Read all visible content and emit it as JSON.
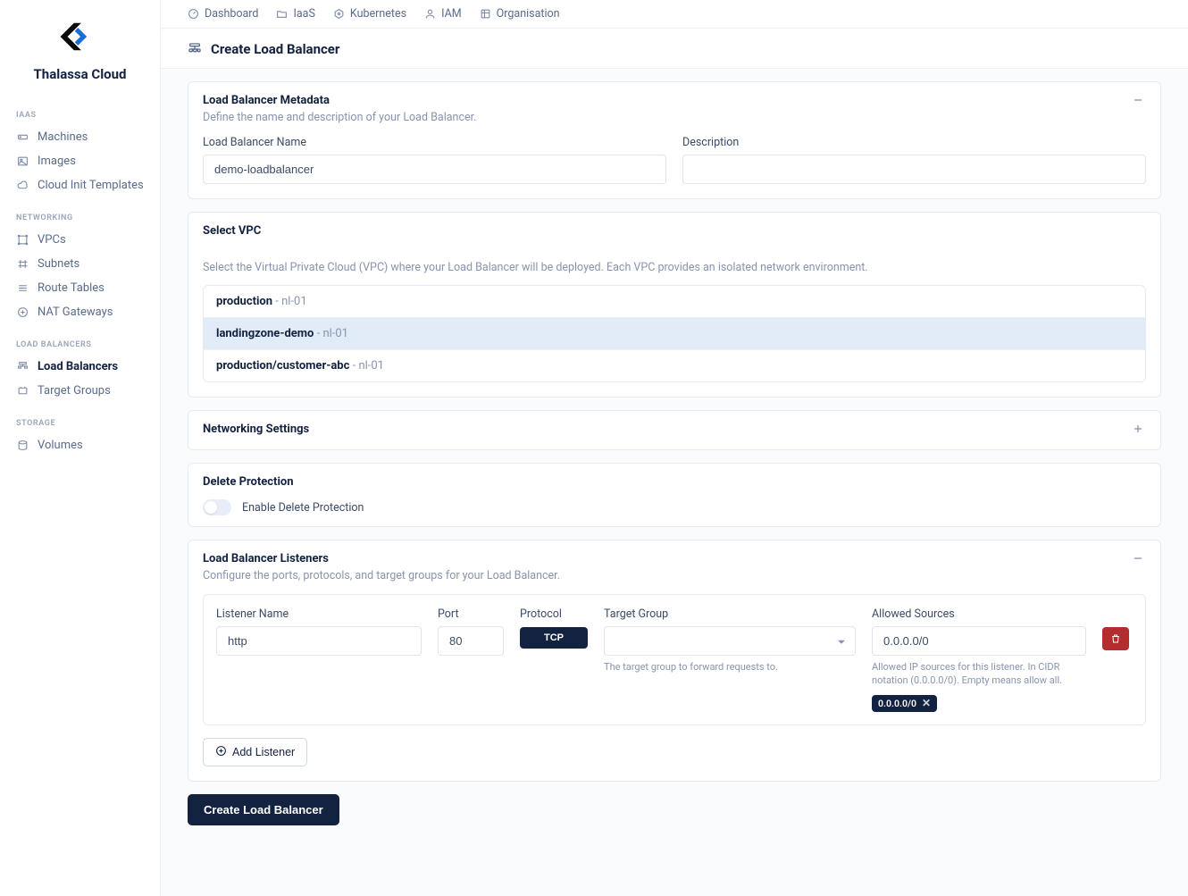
{
  "brand": "Thalassa Cloud",
  "topnav": [
    {
      "label": "Dashboard",
      "icon": "dashboard-icon"
    },
    {
      "label": "IaaS",
      "icon": "folder-icon"
    },
    {
      "label": "Kubernetes",
      "icon": "kubernetes-icon"
    },
    {
      "label": "IAM",
      "icon": "user-icon"
    },
    {
      "label": "Organisation",
      "icon": "org-icon"
    }
  ],
  "pageTitle": "Create Load Balancer",
  "sidebar": {
    "groups": [
      {
        "heading": "IAAS",
        "items": [
          {
            "label": "Machines",
            "icon": "server-icon"
          },
          {
            "label": "Images",
            "icon": "image-icon"
          },
          {
            "label": "Cloud Init Templates",
            "icon": "cloud-icon"
          }
        ]
      },
      {
        "heading": "NETWORKING",
        "items": [
          {
            "label": "VPCs",
            "icon": "vpc-icon"
          },
          {
            "label": "Subnets",
            "icon": "subnet-icon"
          },
          {
            "label": "Route Tables",
            "icon": "route-icon"
          },
          {
            "label": "NAT Gateways",
            "icon": "nat-icon"
          }
        ]
      },
      {
        "heading": "LOAD BALANCERS",
        "items": [
          {
            "label": "Load Balancers",
            "icon": "lb-icon",
            "active": true
          },
          {
            "label": "Target Groups",
            "icon": "target-icon"
          }
        ]
      },
      {
        "heading": "STORAGE",
        "items": [
          {
            "label": "Volumes",
            "icon": "disk-icon"
          }
        ]
      }
    ]
  },
  "metadataCard": {
    "title": "Load Balancer Metadata",
    "sub": "Define the name and description of your Load Balancer.",
    "nameLabel": "Load Balancer Name",
    "nameValue": "demo-loadbalancer",
    "descLabel": "Description",
    "descValue": ""
  },
  "vpcCard": {
    "title": "Select VPC",
    "help": "Select the Virtual Private Cloud (VPC) where your Load Balancer will be deployed. Each VPC provides an isolated network environment.",
    "items": [
      {
        "name": "production",
        "region": "nl-01",
        "selected": false
      },
      {
        "name": "landingzone-demo",
        "region": "nl-01",
        "selected": true
      },
      {
        "name": "production/customer-abc",
        "region": "nl-01",
        "selected": false
      }
    ]
  },
  "netCard": {
    "title": "Networking Settings"
  },
  "deleteCard": {
    "title": "Delete Protection",
    "toggleLabel": "Enable Delete Protection",
    "enabled": false
  },
  "listenersCard": {
    "title": "Load Balancer Listeners",
    "sub": "Configure the ports, protocols, and target groups for your Load Balancer.",
    "headers": {
      "name": "Listener Name",
      "port": "Port",
      "protocol": "Protocol",
      "targetGroup": "Target Group",
      "sources": "Allowed Sources"
    },
    "tgHelp": "The target group to forward requests to.",
    "sourcesHelp": "Allowed IP sources for this listener. In CIDR notation (0.0.0.0/0). Empty means allow all.",
    "listeners": [
      {
        "name": "http",
        "port": "80",
        "protocol": "TCP",
        "targetGroup": "",
        "sourcesInput": "0.0.0.0/0",
        "chips": [
          "0.0.0.0/0"
        ]
      }
    ],
    "addBtn": "Add Listener"
  },
  "submitLabel": "Create Load Balancer"
}
